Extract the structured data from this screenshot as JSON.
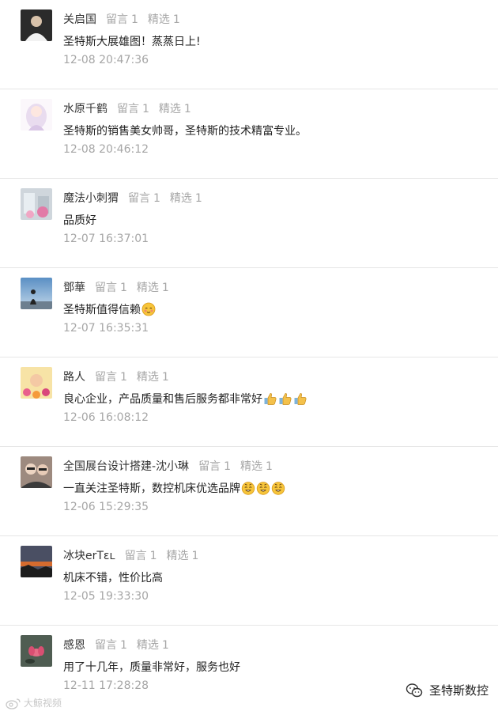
{
  "comments": [
    {
      "nickname": "关启国",
      "reply_label": "留言",
      "reply_count": "1",
      "select_label": "精选",
      "select_count": "1",
      "text": "圣特斯大展雄图！蒸蒸日上!",
      "time": "12-08 20:47:36",
      "avatar": "person-dark",
      "emojis": []
    },
    {
      "nickname": "水原千鹤",
      "reply_label": "留言",
      "reply_count": "1",
      "select_label": "精选",
      "select_count": "1",
      "text": "圣特斯的销售美女帅哥，圣特斯的技术精富专业。",
      "time": "12-08 20:46:12",
      "avatar": "anime-girl",
      "emojis": []
    },
    {
      "nickname": "魔法小刺猬",
      "reply_label": "留言",
      "reply_count": "1",
      "select_label": "精选",
      "select_count": "1",
      "text": "品质好",
      "time": "12-07 16:37:01",
      "avatar": "shop",
      "emojis": []
    },
    {
      "nickname": "鄧華",
      "reply_label": "留言",
      "reply_count": "1",
      "select_label": "精选",
      "select_count": "1",
      "text": "圣特斯值得信赖",
      "time": "12-07 16:35:31",
      "avatar": "silhouette-sky",
      "emojis": [
        "blush"
      ]
    },
    {
      "nickname": "路人",
      "reply_label": "留言",
      "reply_count": "1",
      "select_label": "精选",
      "select_count": "1",
      "text": "良心企业，产品质量和售后服务都非常好",
      "time": "12-06 16:08:12",
      "avatar": "baby-flowers",
      "emojis": [
        "thumbs-up",
        "thumbs-up",
        "thumbs-up"
      ]
    },
    {
      "nickname": "全国展台设计搭建-沈小琳",
      "reply_label": "留言",
      "reply_count": "1",
      "select_label": "精选",
      "select_count": "1",
      "text": "一直关注圣特斯，数控机床优选品牌",
      "time": "12-06 15:29:35",
      "avatar": "two-women",
      "emojis": [
        "smile",
        "smile",
        "smile"
      ]
    },
    {
      "nickname": "冰块erTɛʟ",
      "reply_label": "留言",
      "reply_count": "1",
      "select_label": "精选",
      "select_count": "1",
      "text": "机床不错，性价比高",
      "time": "12-05 19:33:30",
      "avatar": "sunset",
      "emojis": []
    },
    {
      "nickname": "感恩",
      "reply_label": "留言",
      "reply_count": "1",
      "select_label": "精选",
      "select_count": "1",
      "text": "用了十几年，质量非常好，服务也好",
      "time": "12-11 17:28:28",
      "avatar": "lotus",
      "emojis": []
    }
  ],
  "watermark_left": "大鲸视频",
  "watermark_right": "圣特斯数控",
  "colors": {
    "meta_gray": "#a6a6a6",
    "text": "#222222",
    "divider": "#e6e6e6"
  }
}
